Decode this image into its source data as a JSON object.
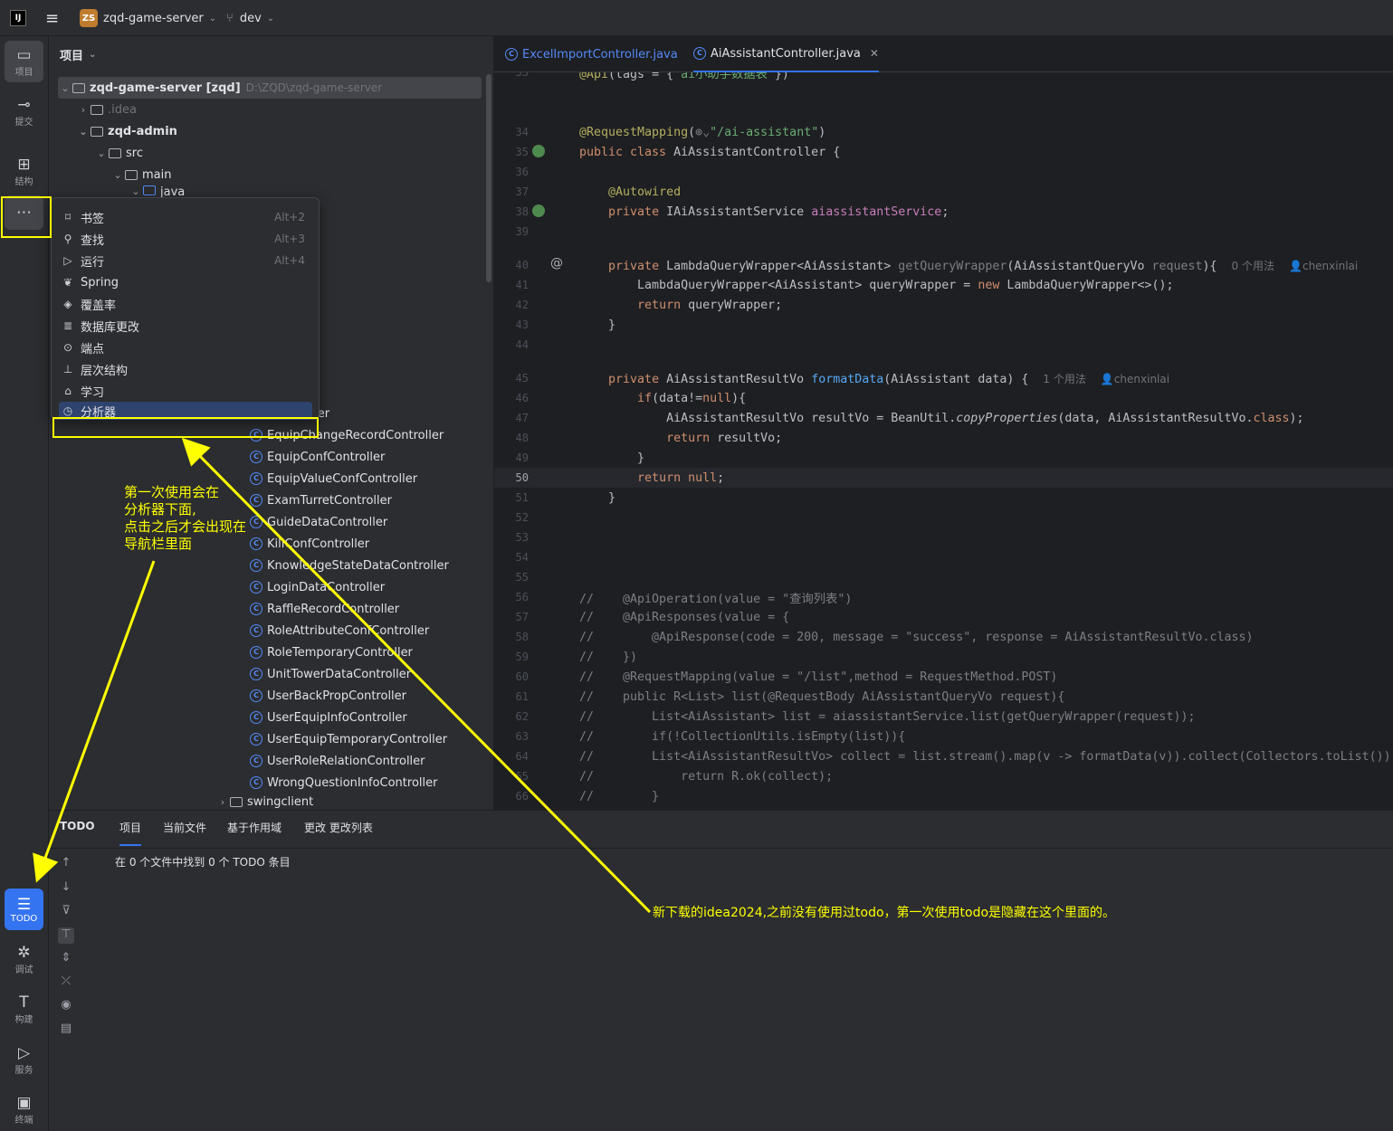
{
  "titlebar": {
    "logo": "IJ",
    "menu_icon": "hamburger-icon",
    "project_badge": "ZS",
    "project_name": "zqd-game-server",
    "branch": "dev"
  },
  "left_toolbar": [
    {
      "label": "项目",
      "icon": "folder-icon"
    },
    {
      "label": "提交",
      "icon": "commit-icon"
    },
    {
      "label": "结构",
      "icon": "structure-icon"
    },
    {
      "label": "",
      "icon": "more-icon"
    },
    {
      "label": "TODO",
      "icon": "todo-list-icon"
    },
    {
      "label": "调试",
      "icon": "bug-icon"
    },
    {
      "label": "构建",
      "icon": "hammer-icon"
    },
    {
      "label": "服务",
      "icon": "services-icon"
    },
    {
      "label": "终端",
      "icon": "terminal-icon"
    }
  ],
  "project_panel": {
    "title": "项目",
    "root_name": "zqd-game-server [zqd]",
    "root_path": "D:\\ZQD\\zqd-game-server",
    "tree": [
      {
        "label": ".idea"
      },
      {
        "label": "zqd-admin"
      },
      {
        "label": "src"
      },
      {
        "label": "main"
      },
      {
        "label": "java"
      }
    ],
    "classes": [
      "tController",
      "EquipChangeRecordController",
      "EquipConfController",
      "EquipValueConfController",
      "ExamTurretController",
      "GuideDataController",
      "KillConfController",
      "KnowledgeStateDataController",
      "LoginDataController",
      "RaffleRecordController",
      "RoleAttributeConfController",
      "RoleTemporaryController",
      "UnitTowerDataController",
      "UserBackPropController",
      "UserEquipInfoController",
      "UserEquipTemporaryController",
      "UserRoleRelationController",
      "WrongQuestionInfoController"
    ],
    "last_folder": "swingclient"
  },
  "popup_menu": [
    {
      "label": "书签",
      "shortcut": "Alt+2",
      "icon": "bookmark-icon"
    },
    {
      "label": "查找",
      "shortcut": "Alt+3",
      "icon": "search-icon"
    },
    {
      "label": "运行",
      "shortcut": "Alt+4",
      "icon": "run-icon"
    },
    {
      "label": "Spring",
      "shortcut": "",
      "icon": "spring-icon"
    },
    {
      "label": "覆盖率",
      "shortcut": "",
      "icon": "coverage-icon"
    },
    {
      "label": "数据库更改",
      "shortcut": "",
      "icon": "database-icon"
    },
    {
      "label": "端点",
      "shortcut": "",
      "icon": "endpoint-icon"
    },
    {
      "label": "层次结构",
      "shortcut": "",
      "icon": "hierarchy-icon"
    },
    {
      "label": "学习",
      "shortcut": "",
      "icon": "learn-icon"
    },
    {
      "label": "分析器",
      "shortcut": "",
      "icon": "profiler-icon"
    }
  ],
  "editor": {
    "tabs": [
      {
        "label": "ExcelImportController.java",
        "active": false
      },
      {
        "label": "AiAssistantController.java",
        "active": true
      }
    ],
    "inlay_usages_0": "0 个用法",
    "inlay_usages_1": "1 个用法",
    "inlay_author": "chenxinlai"
  },
  "bottom_panel": {
    "tabs": [
      "TODO",
      "项目",
      "当前文件",
      "基于作用域",
      "更改 更改列表"
    ],
    "message": "在 0 个文件中找到 0 个 TODO 条目"
  },
  "annotations": {
    "note_left": [
      "第一次使用会在",
      "分析器下面,",
      "点击之后才会出现在",
      "导航栏里面"
    ],
    "note_right": "新下载的idea2024,之前没有使用过todo，第一次使用todo是隐藏在这个里面的。"
  },
  "colors": {
    "accent": "#3574f0",
    "annotation": "#ffff00",
    "background": "#1e1f22",
    "panel": "#2b2d30"
  }
}
